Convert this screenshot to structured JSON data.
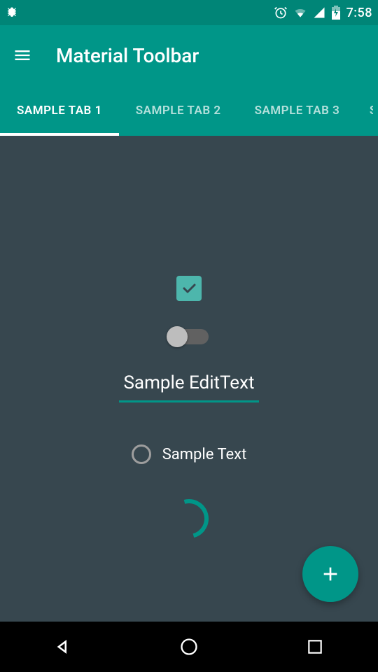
{
  "status_bar": {
    "time": "7:58"
  },
  "toolbar": {
    "title": "Material Toolbar"
  },
  "tabs": [
    {
      "label": "SAMPLE TAB 1",
      "active": true
    },
    {
      "label": "SAMPLE TAB 2",
      "active": false
    },
    {
      "label": "SAMPLE TAB 3",
      "active": false
    },
    {
      "label": "S",
      "active": false
    }
  ],
  "content": {
    "checkbox_checked": true,
    "switch_on": false,
    "edit_text_value": "Sample EditText",
    "radio": {
      "label": "Sample Text",
      "selected": false
    }
  },
  "fab_icon": "plus",
  "colors": {
    "primary": "#009688",
    "primary_dark": "#008577",
    "background": "#37474F"
  }
}
